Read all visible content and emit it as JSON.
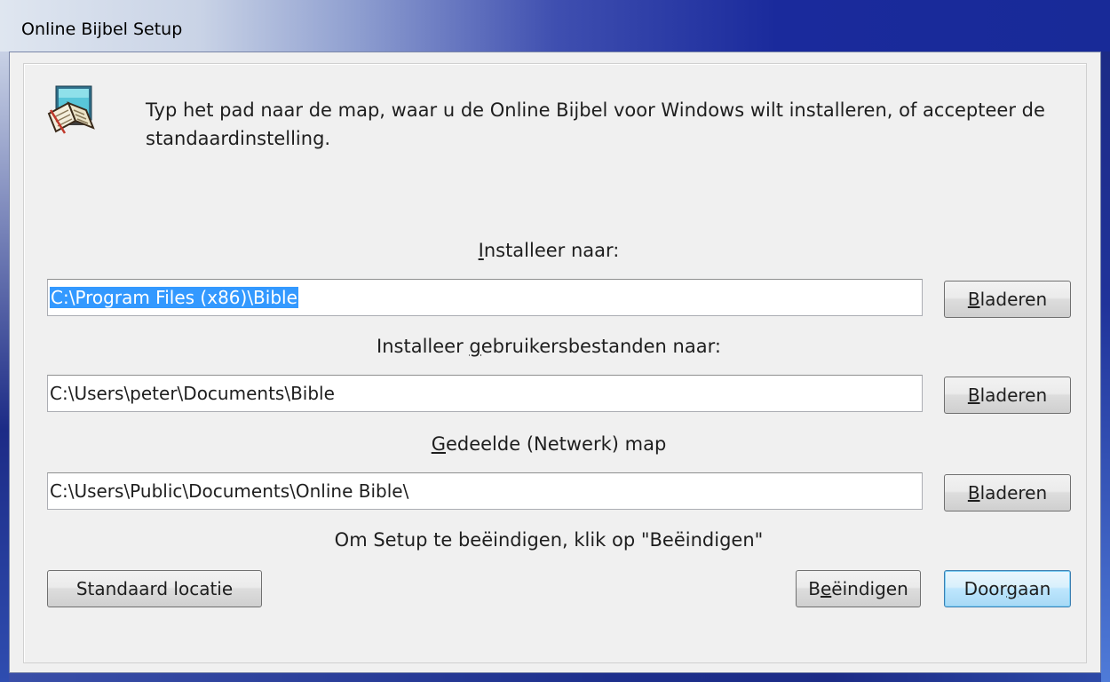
{
  "window": {
    "title": "Online Bijbel Setup"
  },
  "intro": {
    "text": "Typ het pad naar de map, waar u de Online Bijbel voor Windows wilt installeren, of accepteer de standaardinstelling.",
    "icon": "book-setup-icon"
  },
  "install_dir": {
    "label_pre": "",
    "label_mnemonic": "I",
    "label_post": "nstalleer naar:",
    "value": "C:\\Program Files (x86)\\Bible",
    "browse_pre": "",
    "browse_mnemonic": "B",
    "browse_post": "laderen"
  },
  "user_dir": {
    "label_pre": "Installeer ",
    "label_mnemonic": "g",
    "label_post": "ebruikersbestanden naar:",
    "value": "C:\\Users\\peter\\Documents\\Bible",
    "browse_pre": "",
    "browse_mnemonic": "B",
    "browse_post": "laderen"
  },
  "shared_dir": {
    "label_pre": "",
    "label_mnemonic": "G",
    "label_post": "edeelde (Netwerk) map",
    "value": "C:\\Users\\Public\\Documents\\Online Bible\\",
    "browse_pre": "",
    "browse_mnemonic": "B",
    "browse_post": "laderen"
  },
  "footer_note": "Om Setup te beëindigen, klik op \"Beëindigen\"",
  "buttons": {
    "default_location": "Standaard locatie",
    "finish_pre": "B",
    "finish_mnemonic": "e",
    "finish_post": "ëindigen",
    "continue_pre": "Door",
    "continue_mnemonic": "g",
    "continue_post": "aan"
  }
}
